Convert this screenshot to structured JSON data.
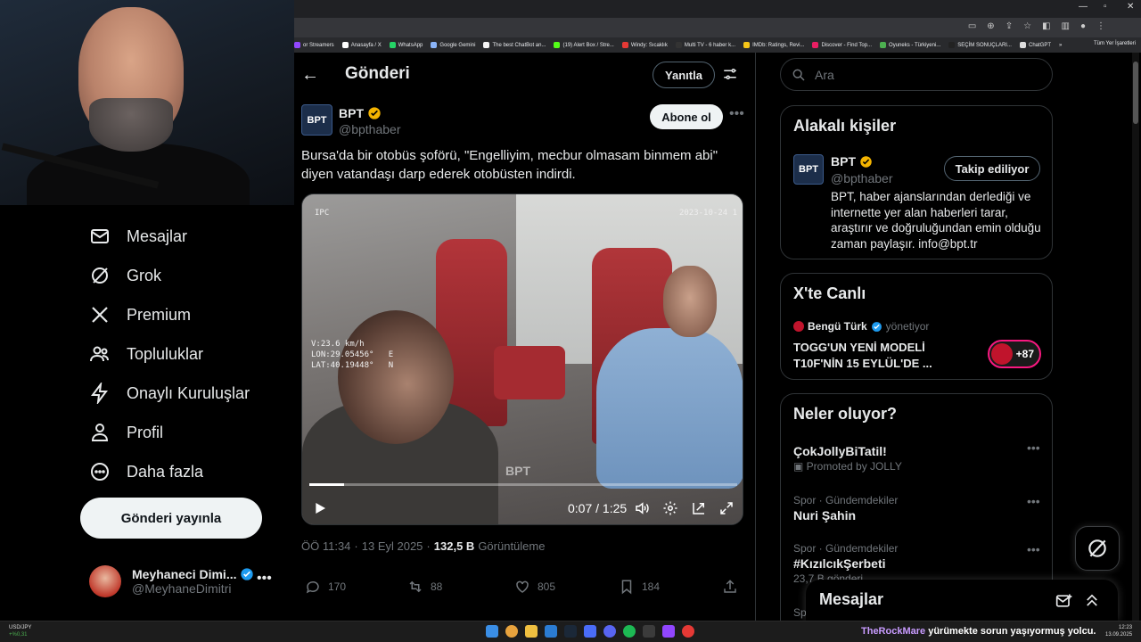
{
  "browser": {
    "bookmarks": [
      {
        "label": "or Streamers",
        "color": "#9147ff"
      },
      {
        "label": "Anasayfa / X",
        "color": "#ffffff"
      },
      {
        "label": "WhatsApp",
        "color": "#25d366"
      },
      {
        "label": "Google Gemini",
        "color": "#8ab4f8"
      },
      {
        "label": "The best ChatBot an...",
        "color": "#f5f5f5"
      },
      {
        "label": "(19) Alert Box / Stre...",
        "color": "#53fc18"
      },
      {
        "label": "Windy: Sıcaklık",
        "color": "#e53935"
      },
      {
        "label": "Multi TV - 6 haber k...",
        "color": "#333333"
      },
      {
        "label": "IMDb: Ratings, Revi...",
        "color": "#f5c518"
      },
      {
        "label": "Discover - Find Top...",
        "color": "#e91e63"
      },
      {
        "label": "Oyuneks - Türkiyeni...",
        "color": "#4caf50"
      },
      {
        "label": "SEÇİM SONUÇLARI...",
        "color": "#222222"
      },
      {
        "label": "ChatGPT",
        "color": "#dddddd"
      }
    ],
    "bookmarks_more": "»",
    "other_bookmarks": "Tüm Yer İşaretleri"
  },
  "nav": {
    "items": [
      {
        "label": "Mesajlar",
        "icon": "envelope-icon"
      },
      {
        "label": "Grok",
        "icon": "grok-icon"
      },
      {
        "label": "Premium",
        "icon": "x-logo-icon"
      },
      {
        "label": "Topluluklar",
        "icon": "people-icon"
      },
      {
        "label": "Onaylı Kuruluşlar",
        "icon": "lightning-icon"
      },
      {
        "label": "Profil",
        "icon": "person-icon"
      },
      {
        "label": "Daha fazla",
        "icon": "more-circle-icon"
      }
    ],
    "post_button": "Gönderi yayınla",
    "account": {
      "name": "Meyhaneci Dimi...",
      "handle": "@MeyhaneDimitri"
    }
  },
  "main": {
    "title": "Gönderi",
    "reply_button": "Yanıtla",
    "post": {
      "avatar_text": "BPT",
      "author": "BPT",
      "handle": "@bpthaber",
      "follow_button": "Abone ol",
      "text": "Bursa'da bir otobüs şoförü, \"Engelliyim, mecbur olmasam binmem abi\" diyen vatandaşı darp ederek otobüsten indirdi.",
      "video": {
        "overlay_left": "IPC",
        "overlay_right": "2023-10-24 1",
        "gps": "V:23.6 km/h\nLON:29.05456°   E\nLAT:40.19448°   N",
        "watermark": "BPT",
        "time": "0:07 / 1:25",
        "progress": 0.082
      },
      "meta": {
        "time": "ÖÖ 11:34",
        "date": "13 Eyl 2025",
        "views": "132,5 B",
        "views_label": "Görüntüleme"
      },
      "stats": {
        "replies": "170",
        "reposts": "88",
        "likes": "805",
        "bookmarks": "184"
      }
    }
  },
  "right": {
    "search_placeholder": "Ara",
    "related": {
      "title": "Alakalı kişiler",
      "avatar_text": "BPT",
      "name": "BPT",
      "handle": "@bpthaber",
      "follow_button": "Takip ediliyor",
      "bio": "BPT, haber ajanslarından derlediği ve internette yer alan haberleri tarar, araştırır ve doğruluğundan emin olduğu zaman paylaşır. info@bpt.tr"
    },
    "live": {
      "title": "X'te Canlı",
      "channel": "Bengü Türk",
      "role": "yönetiyor",
      "headline": "TOGG'UN YENİ MODELİ T10F'NİN 15 EYLÜL'DE ...",
      "listeners": "+87"
    },
    "trends": {
      "title": "Neler oluyor?",
      "items": [
        {
          "category": "",
          "name": "ÇokJollyBiTatil!",
          "sub": "Promoted by JOLLY"
        },
        {
          "category": "Spor · Gündemdekiler",
          "name": "Nuri Şahin",
          "sub": ""
        },
        {
          "category": "Spor · Gündemdekiler",
          "name": "#KızılcıkŞerbeti",
          "sub": "23,7 B gönderi"
        },
        {
          "category": "Spo",
          "name": "",
          "sub": ""
        }
      ]
    },
    "messages_drawer": "Mesajlar"
  },
  "taskbar": {
    "stock_symbol": "USD/JPY",
    "stock_change": "+%0,31",
    "ticker_nick": "TheRockMare",
    "ticker_text": "yürümekte sorun yaşıyormuş yolcu.",
    "clock_time": "12:23",
    "clock_date": "13.09.2025"
  },
  "colors": {
    "verified": "#f4b400",
    "blue_verified": "#1d9bf0",
    "accent_pink": "#f91880"
  }
}
